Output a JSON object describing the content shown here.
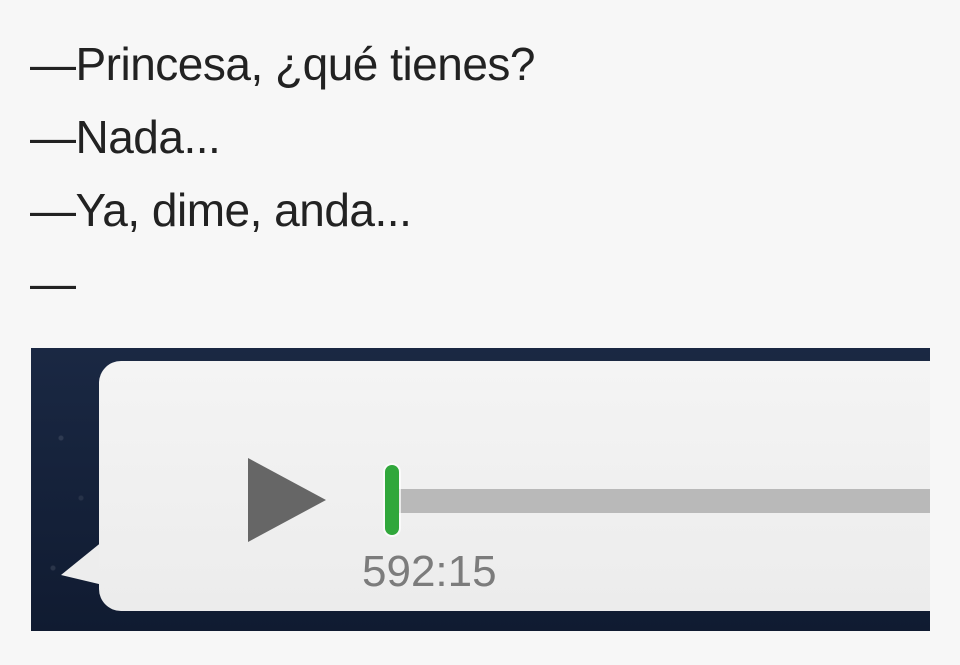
{
  "dialogue": [
    "—Princesa, ¿qué tienes?",
    "—Nada...",
    "—Ya, dime, anda...",
    "—"
  ],
  "voice_message": {
    "duration": "592:15",
    "progress_fraction": 0.0,
    "play_icon": "play-icon",
    "accent_color": "#30a73b"
  }
}
